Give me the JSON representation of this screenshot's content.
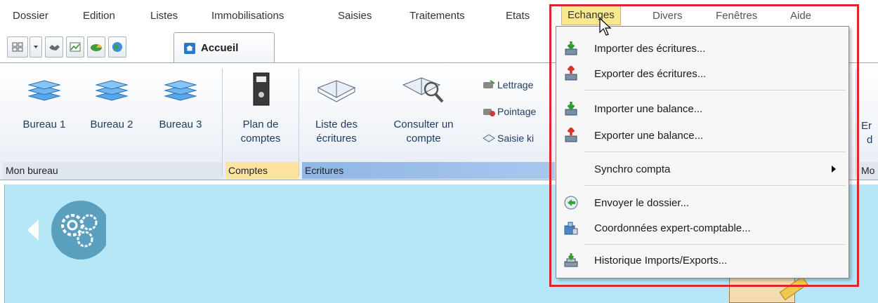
{
  "menubar": {
    "items": [
      "Dossier",
      "Edition",
      "Listes",
      "Immobilisations",
      "Saisies",
      "Traitements",
      "Etats",
      "Echanges",
      "Divers",
      "Fenêtres",
      "Aide"
    ],
    "active": "Echanges"
  },
  "tab": {
    "label": "Accueil"
  },
  "ribbon": {
    "bureau1": "Bureau 1",
    "bureau2": "Bureau 2",
    "bureau3": "Bureau 3",
    "plan_line1": "Plan de",
    "plan_line2": "comptes",
    "liste_line1": "Liste des",
    "liste_line2": "écritures",
    "consulter_line1": "Consulter un",
    "consulter_line2": "compte",
    "lettrage": "Lettrage",
    "pointage": "Pointage",
    "saisie": "Saisie ki",
    "right_partial_1": "Er",
    "right_partial_2": "d",
    "groups": {
      "mon_bureau": "Mon bureau",
      "comptes": "Comptes",
      "ecritures": "Ecritures",
      "right": "Mo"
    }
  },
  "dropdown": {
    "items": [
      {
        "label": "Importer des écritures...",
        "icon": "import-green-icon"
      },
      {
        "label": "Exporter des écritures...",
        "icon": "export-red-icon"
      },
      {
        "label": "Importer une balance...",
        "icon": "import-green-icon"
      },
      {
        "label": "Exporter une balance...",
        "icon": "export-red-icon"
      },
      {
        "label": "Synchro compta",
        "icon": ""
      },
      {
        "label": "Envoyer le dossier...",
        "icon": "send-icon"
      },
      {
        "label": "Coordonnées expert-comptable...",
        "icon": "contact-icon"
      },
      {
        "label": "Historique Imports/Exports...",
        "icon": "history-icon"
      }
    ]
  },
  "colors": {
    "menu_active": "#fbe78e",
    "canvas": "#b5e7f7",
    "highlight": "#e0262b",
    "group_comptes": "#fde3a0",
    "group_ecritures": "#7fa8dd"
  }
}
